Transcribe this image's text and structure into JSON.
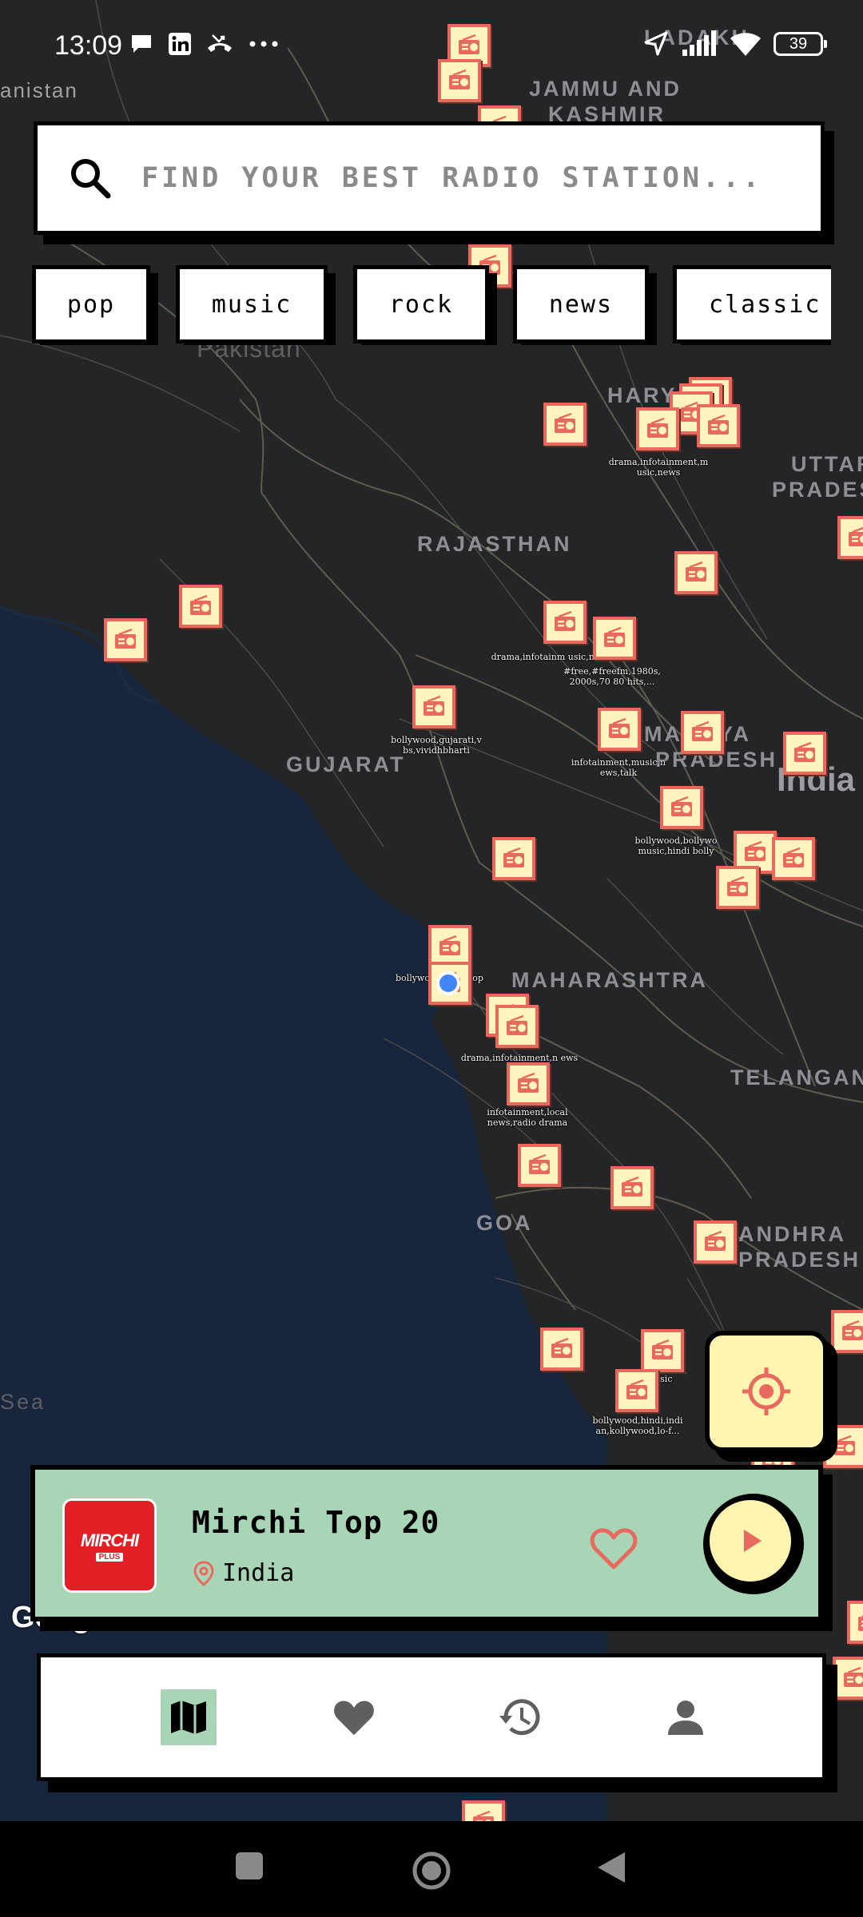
{
  "status_bar": {
    "time": "13:09",
    "notification_icons": [
      "message-bubble-icon",
      "linkedin-icon",
      "missed-call-icon",
      "more-dots-icon"
    ],
    "right_icons": [
      "location-arrow-icon",
      "signal-icon",
      "wifi-icon",
      "battery-icon"
    ],
    "battery_level": "39"
  },
  "search": {
    "placeholder": "FIND YOUR BEST RADIO STATION..."
  },
  "genre_chips": [
    "pop",
    "music",
    "rock",
    "news",
    "classic"
  ],
  "map": {
    "region_labels": {
      "afghanistan": "anistan",
      "jammu": "JAMMU AND",
      "kashmir": "KASHMIR",
      "ladakh": "LADAKH",
      "pakistan": "Pakistan",
      "haryana": "HARYAN",
      "uttar": "UTTAR",
      "pradesh_up": "PRADES",
      "rajasthan": "RAJASTHAN",
      "gujarat": "GUJARAT",
      "madhya": "MADHYA",
      "pradesh_mp": "PRADESH",
      "india": "India",
      "maharashtra": "MAHARASHTRA",
      "telangana": "TELANGAN",
      "goa": "GOA",
      "andhra": "ANDHRA",
      "pradesh_ap": "PRADESH",
      "sea": "Sea"
    },
    "station_tags": [
      "drama,infotainment,m usic,news",
      "drama,infotainm usic,news",
      "#free,#freefm,1980s, 2000s,70 80 hits,...",
      "bollywood,gujarati,v bs,vividhbharti",
      "infotainment,music,n ews,talk",
      "bollywood,bollywo music,hindi bolly",
      "bollywood,hindi,top",
      "drama,infotainment,n ews",
      "infotainment,local news,radio drama",
      "k music",
      "bollywood,hindi,indi an,kollywood,lo-f..."
    ],
    "watermark": "Google"
  },
  "locate_button": {
    "icon": "crosshair-target-icon"
  },
  "now_playing": {
    "logo_text": "MIRCHI",
    "logo_sub": "PLUS",
    "station_name": "Mirchi Top 20",
    "country": "India",
    "favorite_icon": "heart-outline-icon",
    "play_icon": "play-icon"
  },
  "bottom_nav": {
    "items": [
      {
        "icon": "map-icon",
        "active": true
      },
      {
        "icon": "heart-icon",
        "active": false
      },
      {
        "icon": "history-icon",
        "active": false
      },
      {
        "icon": "person-icon",
        "active": false
      }
    ]
  },
  "system_nav": [
    "recents-square-icon",
    "home-circle-icon",
    "back-triangle-icon"
  ],
  "colors": {
    "map_background": "#242527",
    "marker_fill": "#fff4bd",
    "marker_border": "#e86a5e",
    "player_background": "#a8d5b5",
    "fab_background": "#fff4b0",
    "accent_red": "#e86a5e"
  }
}
